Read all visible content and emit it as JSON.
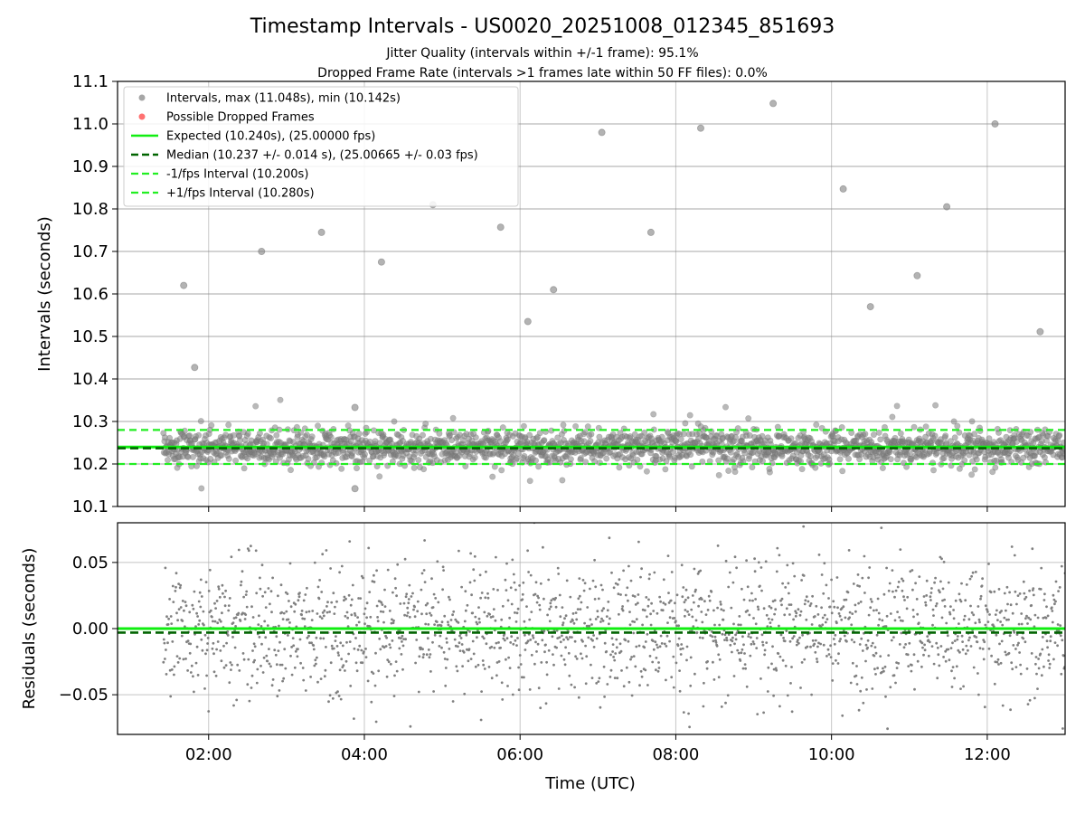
{
  "chart_data": {
    "title": "Timestamp Intervals - US0020_20251008_012345_851693",
    "subtitles": [
      "Jitter Quality (intervals within +/-1 frame): 95.1%",
      "Dropped Frame Rate (intervals >1 frames late within 50 FF files): 0.0%"
    ],
    "colors": {
      "points": "#808080",
      "dropped": "#ff4d4d",
      "expected": "#11ee11",
      "median": "#006400",
      "interval": "#22ee22",
      "grid": "#b0b0b0"
    },
    "x_axis": {
      "label": "Time (UTC)",
      "range_hours": [
        0.83,
        13.0
      ],
      "ticks": [
        {
          "value": 2,
          "label": "02:00"
        },
        {
          "value": 4,
          "label": "04:00"
        },
        {
          "value": 6,
          "label": "06:00"
        },
        {
          "value": 8,
          "label": "08:00"
        },
        {
          "value": 10,
          "label": "10:00"
        },
        {
          "value": 12,
          "label": "12:00"
        }
      ]
    },
    "panels": [
      {
        "type": "scatter",
        "ylabel": "Intervals (seconds)",
        "ylim": [
          10.1,
          11.1
        ],
        "yticks": [
          "10.1",
          "10.2",
          "10.3",
          "10.4",
          "10.5",
          "10.6",
          "10.7",
          "10.8",
          "10.9",
          "11.0",
          "11.1"
        ],
        "grid": true,
        "legend_position": "upper-left",
        "legend": [
          {
            "kind": "dot-gray",
            "label": "Intervals, max (11.048s), min (10.142s)"
          },
          {
            "kind": "dot-red",
            "label": "Possible Dropped Frames"
          },
          {
            "kind": "line-expected",
            "label": "Expected (10.240s), (25.00000 fps)"
          },
          {
            "kind": "dash-median",
            "label": "Median (10.237 +/- 0.014 s), (25.00665 +/- 0.03 fps)"
          },
          {
            "kind": "dash-interval",
            "label": "-1/fps Interval (10.200s)"
          },
          {
            "kind": "dash-interval",
            "label": "+1/fps Interval (10.280s)"
          }
        ],
        "reference_lines": [
          {
            "name": "Expected",
            "value": 10.24,
            "style": "solid"
          },
          {
            "name": "Median",
            "value": 10.237,
            "style": "dashed"
          },
          {
            "name": "-1/fps",
            "value": 10.2,
            "style": "dashed"
          },
          {
            "name": "+1/fps",
            "value": 10.28,
            "style": "dashed"
          }
        ],
        "series": [
          {
            "name": "Intervals",
            "data_range": [
              1.42,
              13.0
            ],
            "bulk_center": 10.24,
            "bulk_spread": 0.02,
            "outliers": [
              {
                "x": 1.68,
                "y": 10.62
              },
              {
                "x": 1.82,
                "y": 10.427
              },
              {
                "x": 2.68,
                "y": 10.7
              },
              {
                "x": 3.45,
                "y": 10.745
              },
              {
                "x": 3.88,
                "y": 10.333
              },
              {
                "x": 3.88,
                "y": 10.142
              },
              {
                "x": 4.22,
                "y": 10.675
              },
              {
                "x": 4.88,
                "y": 10.81
              },
              {
                "x": 5.75,
                "y": 10.757
              },
              {
                "x": 6.1,
                "y": 10.535
              },
              {
                "x": 6.43,
                "y": 10.61
              },
              {
                "x": 7.05,
                "y": 10.98
              },
              {
                "x": 7.68,
                "y": 10.745
              },
              {
                "x": 8.32,
                "y": 10.99
              },
              {
                "x": 9.25,
                "y": 11.048
              },
              {
                "x": 10.15,
                "y": 10.847
              },
              {
                "x": 10.5,
                "y": 10.57
              },
              {
                "x": 11.1,
                "y": 10.643
              },
              {
                "x": 11.48,
                "y": 10.805
              },
              {
                "x": 12.1,
                "y": 11.0
              },
              {
                "x": 12.68,
                "y": 10.511
              }
            ]
          }
        ]
      },
      {
        "type": "scatter",
        "ylabel": "Residuals (seconds)",
        "ylim": [
          -0.08,
          0.08
        ],
        "yticks": [
          {
            "value": 0.05,
            "label": "0.05"
          },
          {
            "value": 0.0,
            "label": "0.00"
          },
          {
            "value": -0.05,
            "label": "−0.05"
          }
        ],
        "grid": true,
        "reference_lines": [
          {
            "name": "Expected",
            "value": 0.0,
            "style": "solid"
          },
          {
            "name": "Median",
            "value": -0.003,
            "style": "dashed"
          }
        ],
        "series": [
          {
            "name": "Residuals",
            "data_range": [
              1.42,
              13.0
            ],
            "bulk_center": 0.0,
            "bulk_spread": 0.025
          }
        ]
      }
    ]
  }
}
